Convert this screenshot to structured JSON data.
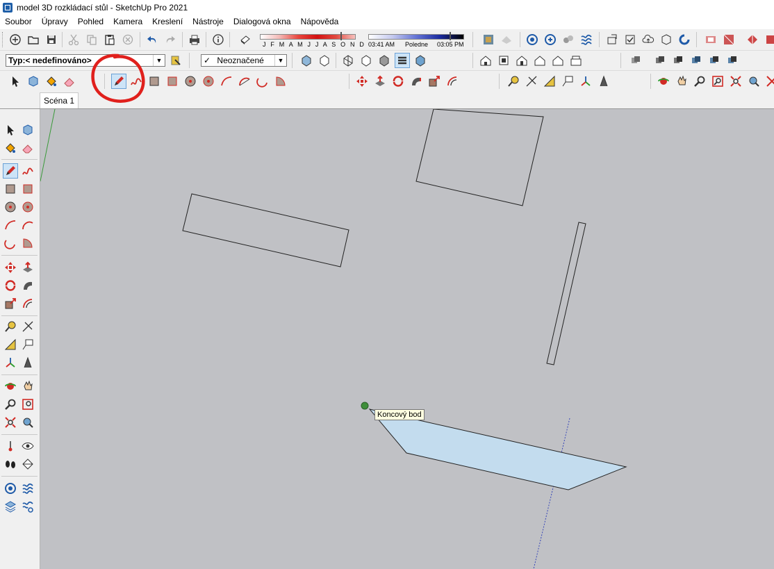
{
  "window": {
    "title": "model 3D rozkládací stůl - SketchUp Pro 2021"
  },
  "menu": [
    "Soubor",
    "Úpravy",
    "Pohled",
    "Kamera",
    "Kreslení",
    "Nástroje",
    "Dialogová okna",
    "Nápověda"
  ],
  "shadow": {
    "months": "J F M A M J J A S O N D",
    "time_start": "03:41 AM",
    "time_mid": "Poledne",
    "time_end": "03:05 PM"
  },
  "tag_combo": {
    "value": "Typ:< nedefinováno>"
  },
  "tag_filter": {
    "check": "✓",
    "value": "Neoznačené"
  },
  "scene_tab": {
    "label": "Scéna 1"
  },
  "viewport": {
    "tooltip": "Koncový bod",
    "background": "#c0c1c5",
    "face_color": "#c3dcee"
  },
  "accent_color": "#e0201c"
}
